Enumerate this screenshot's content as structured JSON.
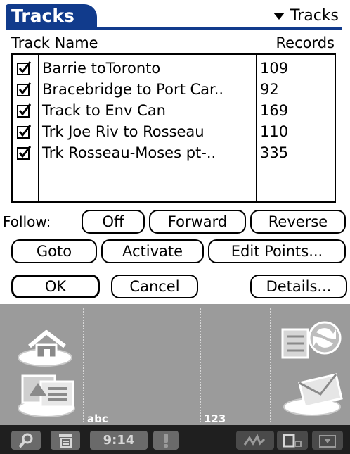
{
  "title": "Tracks",
  "category": {
    "label": "Tracks",
    "icon": "triangle-down-icon"
  },
  "table": {
    "columns": {
      "name": "Track Name",
      "records": "Records"
    },
    "rows": [
      {
        "checked": true,
        "name": "Barrie toToronto",
        "records": "109"
      },
      {
        "checked": true,
        "name": "Bracebridge to Port Car..",
        "records": "92"
      },
      {
        "checked": true,
        "name": "Track to Env Can",
        "records": "169"
      },
      {
        "checked": true,
        "name": "Trk Joe Riv to Rosseau",
        "records": "110"
      },
      {
        "checked": true,
        "name": "Trk Rosseau-Moses pt-..",
        "records": "335"
      }
    ]
  },
  "follow": {
    "label": "Follow:",
    "off": "Off",
    "forward": "Forward",
    "reverse": "Reverse"
  },
  "actions": {
    "goto": "Goto",
    "activate": "Activate",
    "edit_points": "Edit Points..."
  },
  "dialog": {
    "ok": "OK",
    "cancel": "Cancel",
    "details": "Details..."
  },
  "graffiti": {
    "abc_label": "abc",
    "num_label": "123",
    "icons": [
      "home-icon",
      "applications-icon",
      "sync-icon",
      "mail-icon"
    ]
  },
  "statusbar": {
    "time": "9:14",
    "icons": [
      "find-icon",
      "menu-icon",
      "alert-icon",
      "graffiti-icon",
      "screen-rotate-icon",
      "input-toggle-icon"
    ]
  },
  "colors": {
    "title_accent": "#113b8c",
    "graffiti_bg": "#9b9b9b",
    "status_bg": "#1f1f1f"
  }
}
